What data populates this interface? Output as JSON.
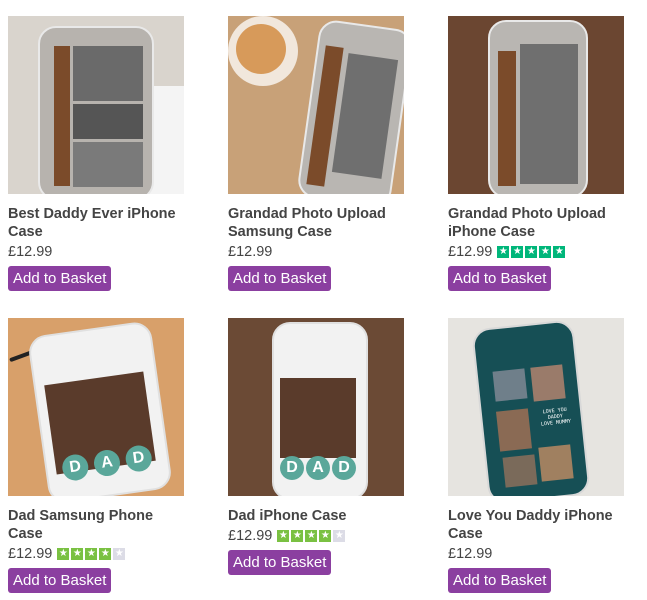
{
  "products": [
    {
      "title": "Best Daddy Ever iPhone Case",
      "price": "£12.99",
      "button": "Add to Basket",
      "rating": null
    },
    {
      "title": "Grandad Photo Upload Samsung Case",
      "price": "£12.99",
      "button": "Add to Basket",
      "rating": null
    },
    {
      "title": "Grandad Photo Upload iPhone Case",
      "price": "£12.99",
      "button": "Add to Basket",
      "rating": 5
    },
    {
      "title": "Dad Samsung Phone Case",
      "price": "£12.99",
      "button": "Add to Basket",
      "rating": 4
    },
    {
      "title": "Dad iPhone Case",
      "price": "£12.99",
      "button": "Add to Basket",
      "rating": 4
    },
    {
      "title": "Love You Daddy iPhone Case",
      "price": "£12.99",
      "button": "Add to Basket",
      "rating": null
    }
  ],
  "case_text": {
    "dad": "DAD",
    "love_you": "LOVE YOU\nDADDY\nLOVE MUMMY"
  },
  "colors": {
    "button": "#8b3fa0",
    "star_green": "#7ac142",
    "star_bright": "#00b67a",
    "star_empty": "#dcdce6"
  }
}
